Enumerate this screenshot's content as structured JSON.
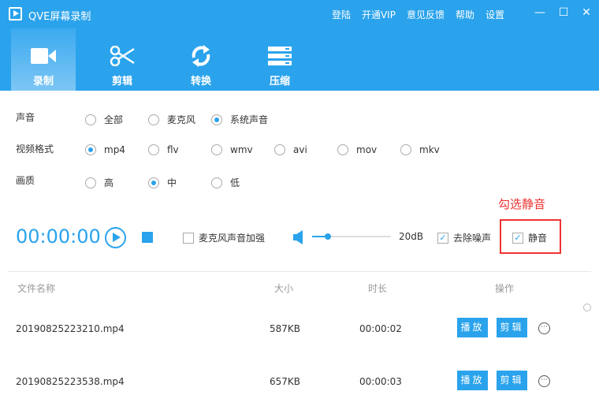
{
  "app": {
    "title": "QVE屏幕录制",
    "nav": [
      "登陆",
      "开通VIP",
      "意见反馈",
      "帮助",
      "设置"
    ]
  },
  "tabs": [
    {
      "label": "录制",
      "icon": "video-camera-icon",
      "active": true
    },
    {
      "label": "剪辑",
      "icon": "scissors-icon"
    },
    {
      "label": "转换",
      "icon": "refresh-icon"
    },
    {
      "label": "压缩",
      "icon": "compress-icon"
    }
  ],
  "settings": {
    "sound": {
      "label": "声音",
      "options": [
        "全部",
        "麦克风",
        "系统声音"
      ],
      "selected": "系统声音"
    },
    "format": {
      "label": "视频格式",
      "options": [
        "mp4",
        "flv",
        "wmv",
        "avi",
        "mov",
        "mkv"
      ],
      "selected": "mp4"
    },
    "quality": {
      "label": "画质",
      "options": [
        "高",
        "中",
        "低"
      ],
      "selected": "中"
    }
  },
  "recorder": {
    "time": "00:00:00",
    "mic_boost": "麦克风声音加强",
    "mic_boost_checked": false,
    "volume_db": "20dB",
    "volume_level": 0.2,
    "denoise": "去除噪声",
    "denoise_checked": true,
    "mute": "静音",
    "mute_checked": true
  },
  "annotation": {
    "text": "勾选静音",
    "color": "#ee3333"
  },
  "table": {
    "headers": [
      "文件名称",
      "大小",
      "时长",
      "操作"
    ],
    "rows": [
      {
        "name": "20190825223210.mp4",
        "size": "587KB",
        "duration": "00:00:02"
      },
      {
        "name": "20190825223538.mp4",
        "size": "657KB",
        "duration": "00:00:03"
      }
    ],
    "play": "播放",
    "edit": "剪辑"
  },
  "colors": {
    "accent": "#2aa3ec"
  }
}
